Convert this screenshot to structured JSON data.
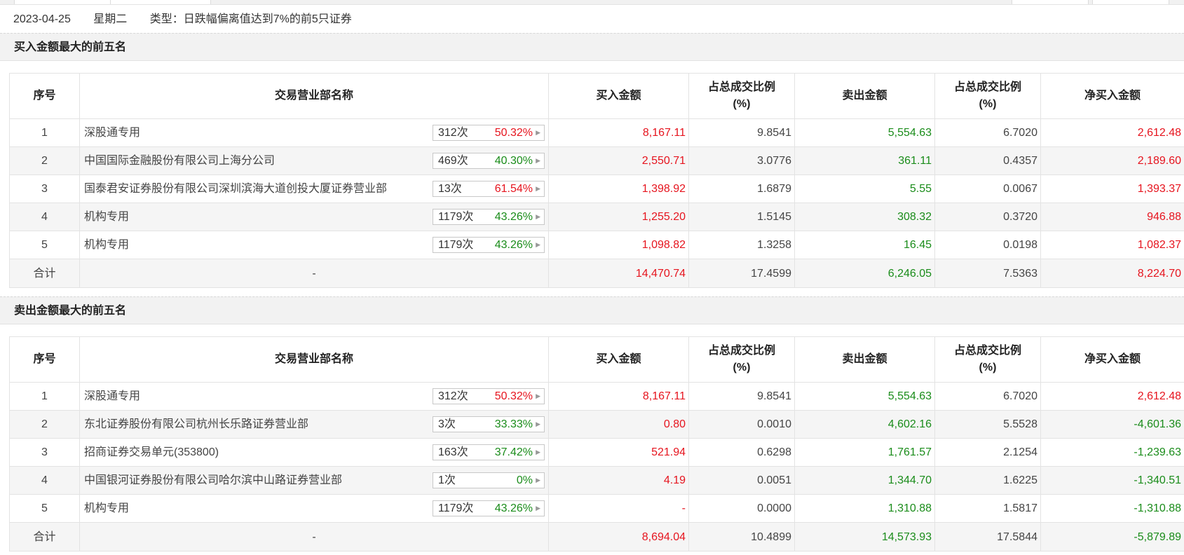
{
  "info": {
    "date": "2023-04-25",
    "weekday": "星期二",
    "type_text": "类型：日跌幅偏离值达到7%的前5只证券"
  },
  "colors": {
    "red": "#e6141e",
    "green": "#1a8c1a"
  },
  "columns": {
    "seq": "序号",
    "dept": "交易营业部名称",
    "buy": "买入金额",
    "ratio_line1": "占总成交比例",
    "ratio_line2": "(%)",
    "sell": "卖出金额",
    "net": "净买入金额"
  },
  "buy_section": {
    "title": "买入金额最大的前五名",
    "rows": [
      {
        "seq": "1",
        "name": "深股通专用",
        "count": "312次",
        "pct": "50.32%",
        "pct_color": "red",
        "buy": "8,167.11",
        "buy_ratio": "9.8541",
        "sell": "5,554.63",
        "sell_ratio": "6.7020",
        "net": "2,612.48",
        "net_color": "red"
      },
      {
        "seq": "2",
        "name": "中国国际金融股份有限公司上海分公司",
        "count": "469次",
        "pct": "40.30%",
        "pct_color": "green",
        "buy": "2,550.71",
        "buy_ratio": "3.0776",
        "sell": "361.11",
        "sell_ratio": "0.4357",
        "net": "2,189.60",
        "net_color": "red"
      },
      {
        "seq": "3",
        "name": "国泰君安证券股份有限公司深圳滨海大道创投大厦证券营业部",
        "count": "13次",
        "pct": "61.54%",
        "pct_color": "red",
        "buy": "1,398.92",
        "buy_ratio": "1.6879",
        "sell": "5.55",
        "sell_ratio": "0.0067",
        "net": "1,393.37",
        "net_color": "red"
      },
      {
        "seq": "4",
        "name": "机构专用",
        "count": "1179次",
        "pct": "43.26%",
        "pct_color": "green",
        "buy": "1,255.20",
        "buy_ratio": "1.5145",
        "sell": "308.32",
        "sell_ratio": "0.3720",
        "net": "946.88",
        "net_color": "red"
      },
      {
        "seq": "5",
        "name": "机构专用",
        "count": "1179次",
        "pct": "43.26%",
        "pct_color": "green",
        "buy": "1,098.82",
        "buy_ratio": "1.3258",
        "sell": "16.45",
        "sell_ratio": "0.0198",
        "net": "1,082.37",
        "net_color": "red"
      }
    ],
    "total": {
      "label": "合计",
      "dash": "-",
      "buy": "14,470.74",
      "buy_ratio": "17.4599",
      "sell": "6,246.05",
      "sell_ratio": "7.5363",
      "net": "8,224.70",
      "net_color": "red"
    }
  },
  "sell_section": {
    "title": "卖出金额最大的前五名",
    "rows": [
      {
        "seq": "1",
        "name": "深股通专用",
        "count": "312次",
        "pct": "50.32%",
        "pct_color": "red",
        "buy": "8,167.11",
        "buy_ratio": "9.8541",
        "sell": "5,554.63",
        "sell_ratio": "6.7020",
        "net": "2,612.48",
        "net_color": "red"
      },
      {
        "seq": "2",
        "name": "东北证券股份有限公司杭州长乐路证券营业部",
        "count": "3次",
        "pct": "33.33%",
        "pct_color": "green",
        "buy": "0.80",
        "buy_ratio": "0.0010",
        "sell": "4,602.16",
        "sell_ratio": "5.5528",
        "net": "-4,601.36",
        "net_color": "green"
      },
      {
        "seq": "3",
        "name": "招商证券交易单元(353800)",
        "count": "163次",
        "pct": "37.42%",
        "pct_color": "green",
        "buy": "521.94",
        "buy_ratio": "0.6298",
        "sell": "1,761.57",
        "sell_ratio": "2.1254",
        "net": "-1,239.63",
        "net_color": "green"
      },
      {
        "seq": "4",
        "name": "中国银河证券股份有限公司哈尔滨中山路证券营业部",
        "count": "1次",
        "pct": "0%",
        "pct_color": "green",
        "buy": "4.19",
        "buy_ratio": "0.0051",
        "sell": "1,344.70",
        "sell_ratio": "1.6225",
        "net": "-1,340.51",
        "net_color": "green"
      },
      {
        "seq": "5",
        "name": "机构专用",
        "count": "1179次",
        "pct": "43.26%",
        "pct_color": "green",
        "buy": "-",
        "buy_ratio": "0.0000",
        "sell": "1,310.88",
        "sell_ratio": "1.5817",
        "net": "-1,310.88",
        "net_color": "green"
      }
    ],
    "total": {
      "label": "合计",
      "dash": "-",
      "buy": "8,694.04",
      "buy_ratio": "10.4899",
      "sell": "14,573.93",
      "sell_ratio": "17.5844",
      "net": "-5,879.89",
      "net_color": "green"
    }
  }
}
